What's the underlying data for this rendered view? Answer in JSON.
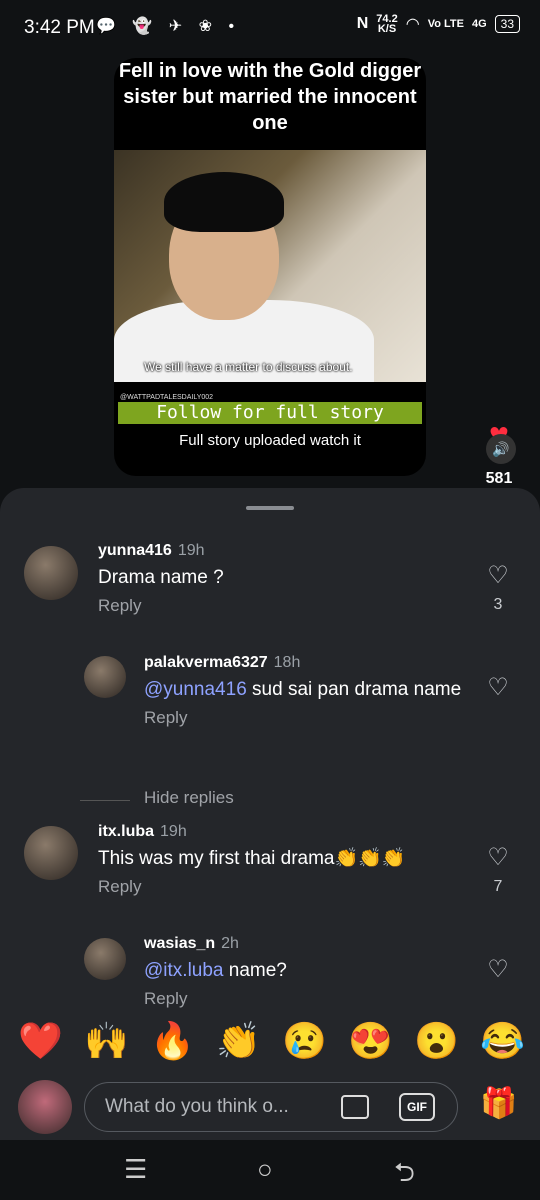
{
  "status": {
    "time": "3:42 PM",
    "icons": "💬 👻 ✈ ❀ •",
    "speed_value": "74.2",
    "speed_unit": "K/S",
    "network": "Vo LTE",
    "signal": "4G",
    "battery": "33"
  },
  "video": {
    "title": "Fell in love with the Gold digger sister but married the innocent one",
    "subtitle": "We still have a matter to discuss about.",
    "handle": "@WATTPADTALESDAILY002",
    "follow_banner": "Follow for full story",
    "caption": "Full story uploaded watch it"
  },
  "rail": {
    "like_count": "581"
  },
  "comments": [
    {
      "user": "yunna416",
      "time": "19h",
      "text": "Drama name ?",
      "reply": "Reply",
      "likes": "3"
    },
    {
      "user": "palakverma6327",
      "time": "18h",
      "mention": "@yunna416",
      "text": " sud sai pan drama name",
      "reply": "Reply"
    },
    {
      "user": "itx.luba",
      "time": "19h",
      "text": "This was my first thai drama👏👏👏",
      "reply": "Reply",
      "likes": "7"
    },
    {
      "user": "wasias_n",
      "time": "2h",
      "mention": "@itx.luba",
      "text": " name?",
      "reply": "Reply"
    }
  ],
  "hide_replies": "Hide replies",
  "reactions": [
    "❤️",
    "🙌",
    "🔥",
    "👏",
    "😢",
    "😍",
    "😮",
    "😂"
  ],
  "composer": {
    "placeholder": "What do you think o...",
    "gif": "GIF"
  },
  "nav": {
    "recents": "☰",
    "home": "○",
    "back": "⮌"
  }
}
